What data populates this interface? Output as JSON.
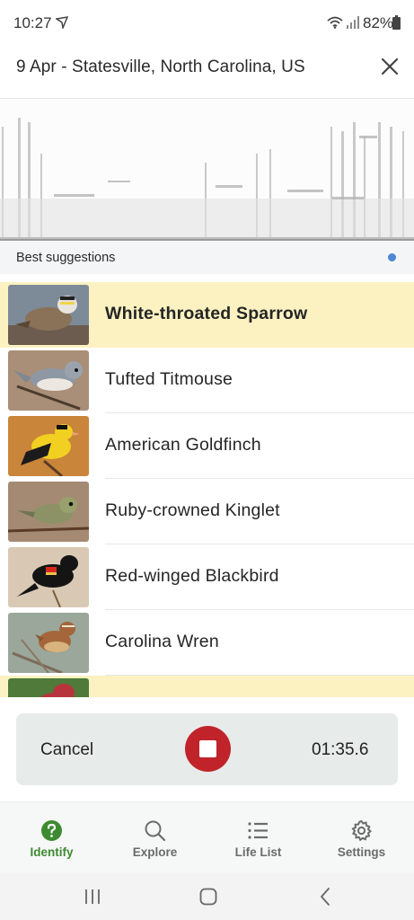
{
  "status_bar": {
    "time": "10:27",
    "battery": "82%"
  },
  "header": {
    "title": "9 Apr - Statesville, North Carolina, US",
    "close_icon": "close-icon"
  },
  "suggestions": {
    "title": "Best suggestions",
    "dot_color": "#4f86d6"
  },
  "birds": [
    {
      "name": "White-throated Sparrow",
      "highlighted": true
    },
    {
      "name": "Tufted Titmouse",
      "highlighted": false
    },
    {
      "name": "American Goldfinch",
      "highlighted": false
    },
    {
      "name": "Ruby-crowned Kinglet",
      "highlighted": false
    },
    {
      "name": "Red-winged Blackbird",
      "highlighted": false
    },
    {
      "name": "Carolina Wren",
      "highlighted": false
    },
    {
      "name": "",
      "highlighted": true
    }
  ],
  "recording": {
    "cancel_label": "Cancel",
    "timer": "01:35.6",
    "stop_color": "#c0242a"
  },
  "bottom_nav": {
    "items": [
      {
        "label": "Identify",
        "icon": "question-icon",
        "active": true
      },
      {
        "label": "Explore",
        "icon": "search-icon",
        "active": false
      },
      {
        "label": "Life List",
        "icon": "list-icon",
        "active": false
      },
      {
        "label": "Settings",
        "icon": "gear-icon",
        "active": false
      }
    ],
    "active_color": "#3d8b31"
  },
  "colors": {
    "highlight": "#fcf2c1",
    "accent_green": "#3d8b31"
  }
}
